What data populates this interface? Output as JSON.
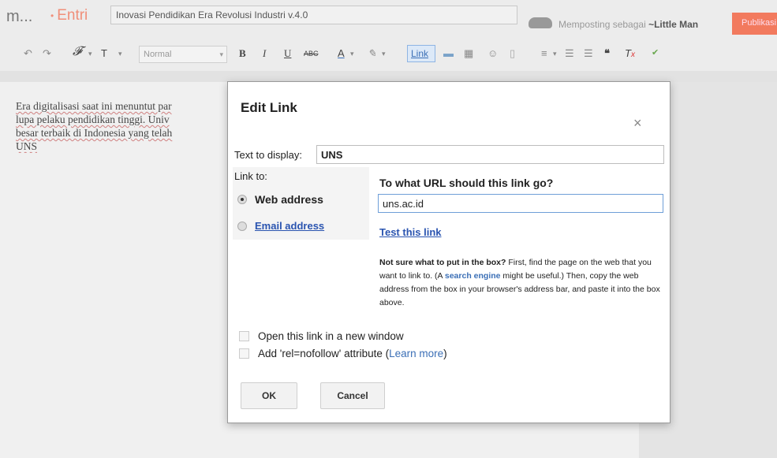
{
  "header": {
    "brand": "m...",
    "section_dot": "•",
    "section": "Entri",
    "post_title": "Inovasi Pendidikan Era Revolusi Industri v.4.0",
    "posting_as_prefix": "Memposting sebagai",
    "posting_as_user": "~Little Man",
    "publish_label": "Publikasi"
  },
  "toolbar": {
    "format_select": "Normal",
    "link_label": "Link"
  },
  "editor": {
    "lines": [
      "Era digitalisasi saat ini menuntut par",
      "lupa pelaku pendidikan tinggi. Univ",
      "besar terbaik di Indonesia yang telah",
      "UNS"
    ]
  },
  "dialog": {
    "title": "Edit Link",
    "close_symbol": "×",
    "display_label": "Text to display:",
    "display_value": "UNS",
    "link_to_label": "Link to:",
    "option_web": "Web address",
    "option_email": "Email address",
    "url_heading": "To what URL should this link go?",
    "url_value": "uns.ac.id",
    "test_link": "Test this link",
    "help_bold": "Not sure what to put in the box?",
    "help_1": " First, find the page on the web that you want to link to. (A ",
    "help_link": "search engine",
    "help_2": " might be useful.) Then, copy the web address from the box in your browser's address bar, and paste it into the box above.",
    "new_window_label": "Open this link in a new window",
    "nofollow_label": "Add 'rel=nofollow' attribute (",
    "learn_more": "Learn more",
    "nofollow_close": ")",
    "ok_label": "OK",
    "cancel_label": "Cancel"
  },
  "colors": {
    "accent": "#f27a5e",
    "link": "#2a54b0"
  }
}
